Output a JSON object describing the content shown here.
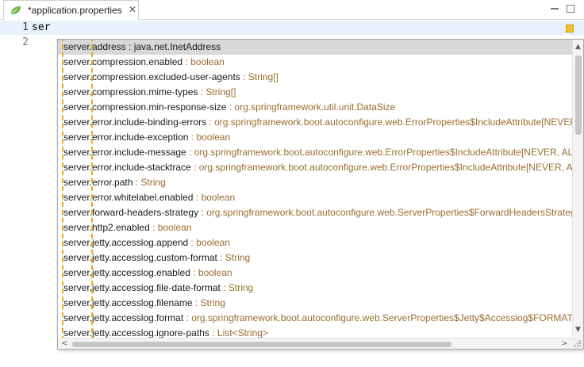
{
  "tab": {
    "title": "*application.properties",
    "close": "✕"
  },
  "editor": {
    "lines": [
      {
        "number": "1",
        "text": "ser"
      },
      {
        "number": "2",
        "text": ""
      }
    ]
  },
  "popup": {
    "items": [
      {
        "name": "server.address",
        "type": "java.net.InetAddress"
      },
      {
        "name": "server.compression.enabled",
        "type": "boolean"
      },
      {
        "name": "server.compression.excluded-user-agents",
        "type": "String[]"
      },
      {
        "name": "server.compression.mime-types",
        "type": "String[]"
      },
      {
        "name": "server.compression.min-response-size",
        "type": "org.springframework.util.unit.DataSize"
      },
      {
        "name": "server.error.include-binding-errors",
        "type": "org.springframework.boot.autoconfigure.web.ErrorProperties$IncludeAttribute[NEVER, ALWAYS, ON_PARAM]"
      },
      {
        "name": "server.error.include-exception",
        "type": "boolean"
      },
      {
        "name": "server.error.include-message",
        "type": "org.springframework.boot.autoconfigure.web.ErrorProperties$IncludeAttribute[NEVER, ALWAYS, ON_PARAM]"
      },
      {
        "name": "server.error.include-stacktrace",
        "type": "org.springframework.boot.autoconfigure.web.ErrorProperties$IncludeAttribute[NEVER, ALWAYS, ON_PARAM]"
      },
      {
        "name": "server.error.path",
        "type": "String"
      },
      {
        "name": "server.error.whitelabel.enabled",
        "type": "boolean"
      },
      {
        "name": "server.forward-headers-strategy",
        "type": "org.springframework.boot.autoconfigure.web.ServerProperties$ForwardHeadersStrategy[NATIVE, FRAMEWORK, NONE]"
      },
      {
        "name": "server.http2.enabled",
        "type": "boolean"
      },
      {
        "name": "server.jetty.accesslog.append",
        "type": "boolean"
      },
      {
        "name": "server.jetty.accesslog.custom-format",
        "type": "String"
      },
      {
        "name": "server.jetty.accesslog.enabled",
        "type": "boolean"
      },
      {
        "name": "server.jetty.accesslog.file-date-format",
        "type": "String"
      },
      {
        "name": "server.jetty.accesslog.filename",
        "type": "String"
      },
      {
        "name": "server.jetty.accesslog.format",
        "type": "org.springframework.boot.autoconfigure.web.ServerProperties$Jetty$Accesslog$FORMAT[NCSA, EXTENDED_NCSA]"
      },
      {
        "name": "server.jetty.accesslog.ignore-paths",
        "type": "List<String>"
      }
    ],
    "separator": " : ",
    "scroll_up": "▲",
    "scroll_down": "▼",
    "scroll_left": "<",
    "scroll_right": ">"
  },
  "colors": {
    "selection": "#d8d8d8",
    "type_text": "#9a6d2e",
    "highlight_box": "#f5a623",
    "current_line": "#e8f2fe"
  }
}
